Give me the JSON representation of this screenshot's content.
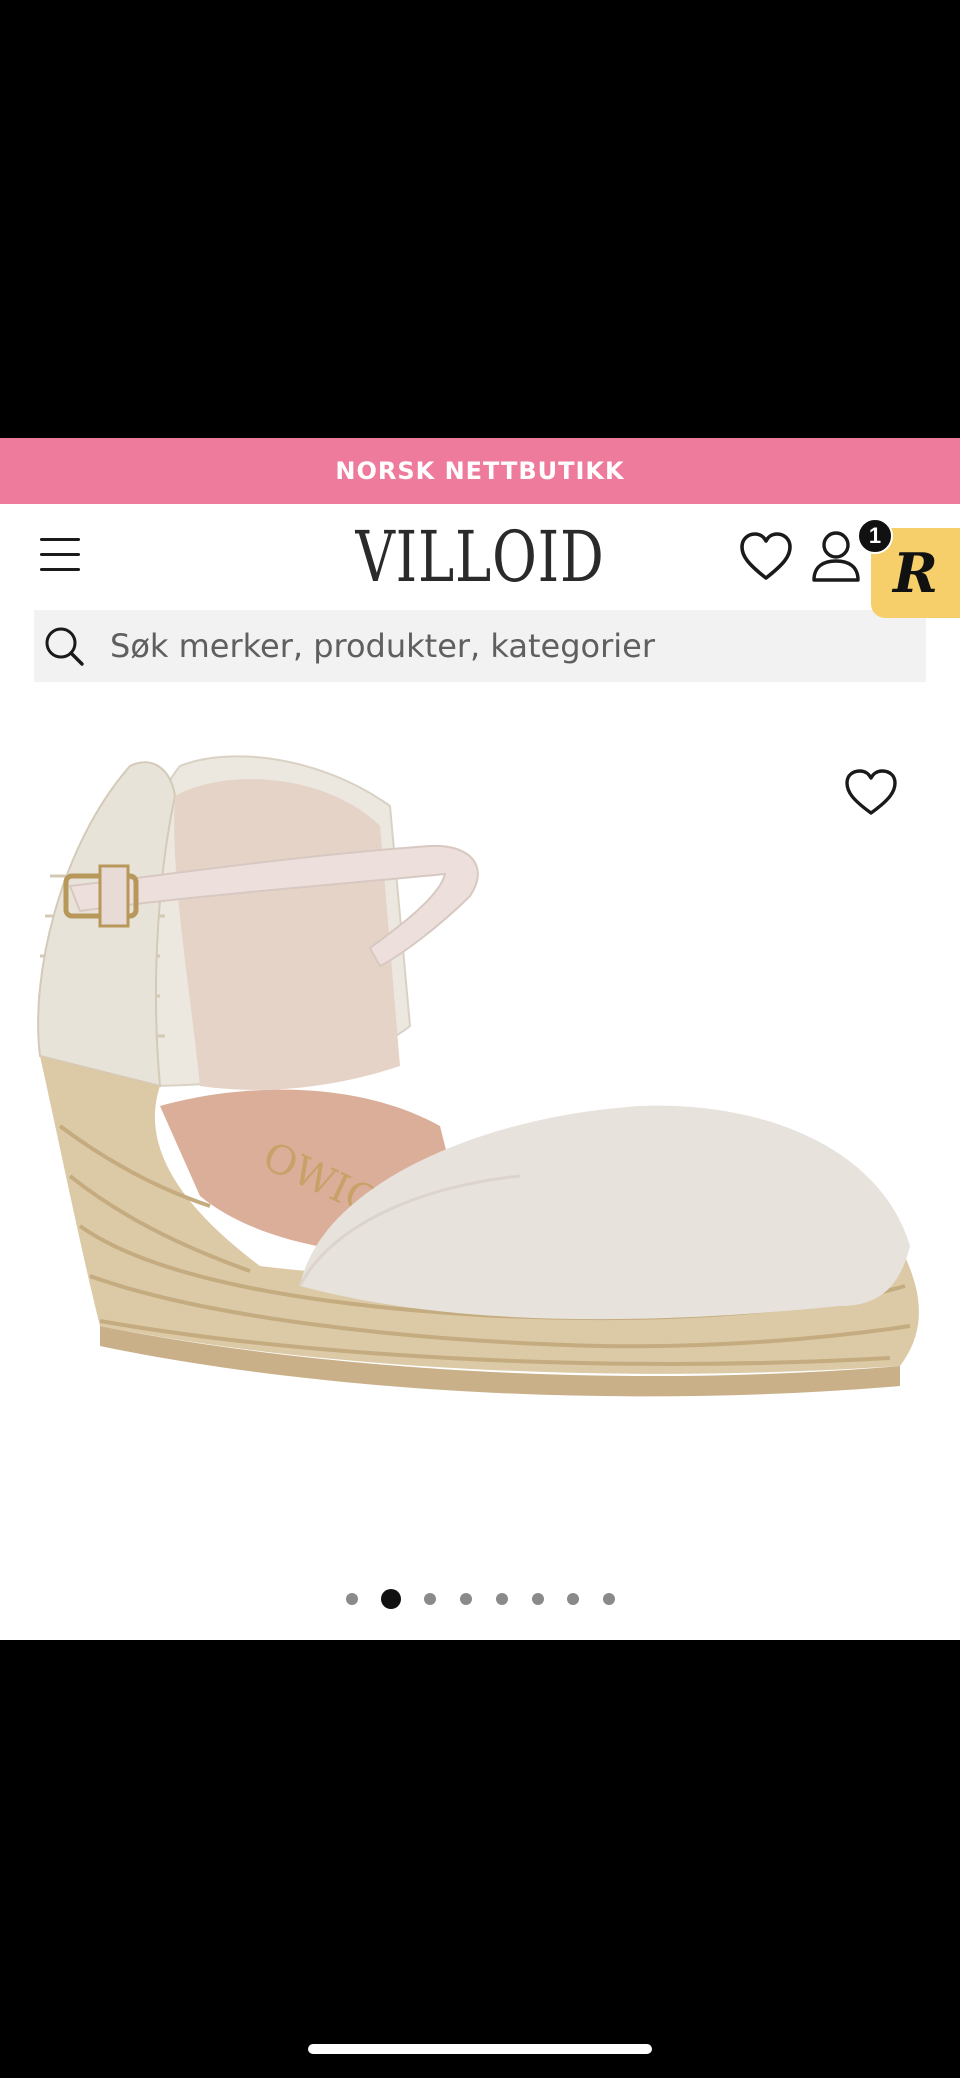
{
  "promo": {
    "text": "NORSK NETTBUTIKK"
  },
  "header": {
    "logo_text": "VILLOID",
    "cart_count": "1",
    "rewards_badge_letter": "R"
  },
  "search": {
    "placeholder": "Søk merker, produkter, kategorier",
    "value": ""
  },
  "icons": {
    "menu": "hamburger-menu-icon",
    "wishlist": "heart-icon",
    "account": "user-icon",
    "search": "magnifier-icon",
    "favorite": "heart-outline-icon"
  },
  "product": {
    "image_description_logo": "OWIO",
    "carousel": {
      "total": 8,
      "active_index": 1
    }
  },
  "colors": {
    "promo_bg": "#EE7A9C",
    "rewards_badge_bg": "#F7CF6A",
    "search_bg": "#F2F2F2"
  }
}
